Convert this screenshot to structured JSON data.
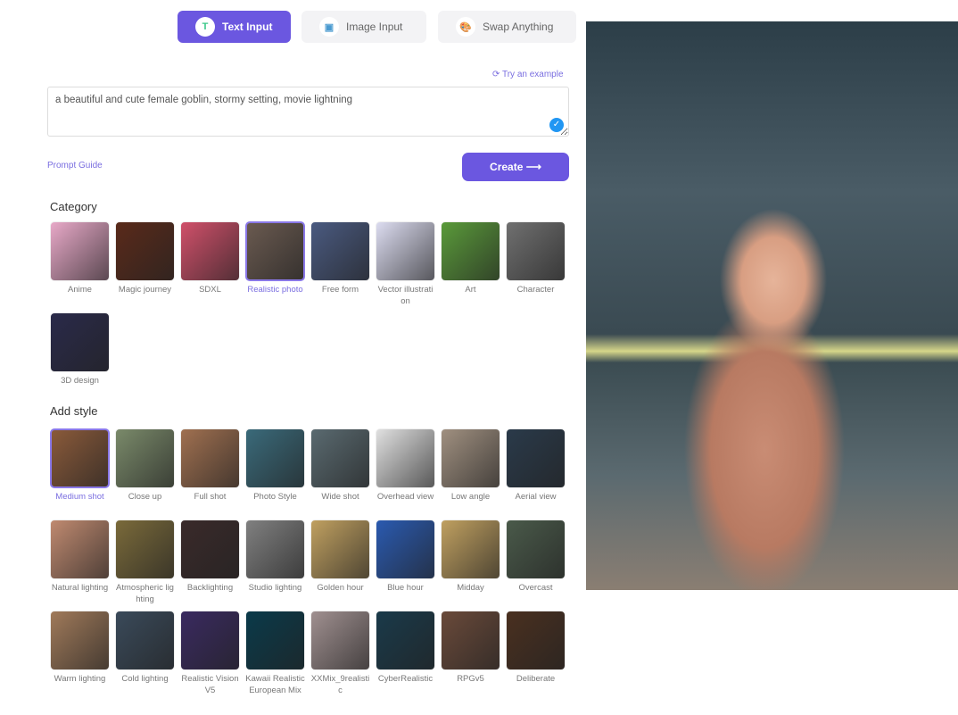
{
  "tabs": [
    {
      "label": "Text Input",
      "icon": "text-icon",
      "active": true
    },
    {
      "label": "Image Input",
      "icon": "image-icon"
    },
    {
      "label": "Swap Anything",
      "icon": "palette-icon"
    }
  ],
  "try_example": "Try an example",
  "prompt": "a beautiful and cute female goblin, stormy setting, movie lightning",
  "prompt_guide": "Prompt Guide",
  "create": "Create",
  "category_title": "Category",
  "categories": [
    "Anime",
    "Magic journey",
    "SDXL",
    "Realistic photo",
    "Free form",
    "Vector illustration",
    "Art",
    "Character",
    "3D design"
  ],
  "category_selected": 3,
  "style_title": "Add style",
  "styles": [
    "Medium shot",
    "Close up",
    "Full shot",
    "Photo Style",
    "Wide shot",
    "Overhead view",
    "Low angle",
    "Aerial view",
    "Natural lighting",
    "Atmospheric lighting",
    "Backlighting",
    "Studio lighting",
    "Golden hour",
    "Blue hour",
    "Midday",
    "Overcast",
    "Warm lighting",
    "Cold lighting",
    "Realistic Vision V5",
    "Kawaii Realistic European Mix",
    "XXMix_9realistic",
    "CyberRealistic",
    "RPGv5",
    "Deliberate"
  ],
  "style_selected": 0,
  "accent": "#6b57e0",
  "thumb_colors": [
    "#e8a9c8",
    "#5a2a1a",
    "#d0506a",
    "#6a5a50",
    "#4a5a80",
    "#dcdcf0",
    "#5a9a3a",
    "#707070",
    "#2a2a4a",
    "#8a5a3a",
    "#7a8a6a",
    "#a07050",
    "#3a6a7a",
    "#5a6a70",
    "#e0e0e0",
    "#a09080",
    "#2a3a4a",
    "#c08a70",
    "#7a6a3a",
    "#3a2a2a",
    "#808080",
    "#c0a060",
    "#2a5ab0",
    "#c0a060",
    "#4a5a4a",
    "#a07a5a",
    "#3a4a5a",
    "#3a2a60",
    "#0a3a4a",
    "#a09090",
    "#1a3a4a",
    "#6a4a3a",
    "#4a3020",
    "#5a3a2a"
  ]
}
